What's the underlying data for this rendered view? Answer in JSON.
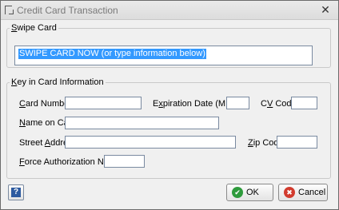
{
  "window": {
    "title": "Credit Card Transaction",
    "close_glyph": "✕"
  },
  "swipe": {
    "legend_key": "S",
    "legend_rest": "wipe Card",
    "field_value": "SWIPE CARD NOW (or type information below)"
  },
  "key_in": {
    "legend_key": "K",
    "legend_rest": "ey in Card Information",
    "card_number": {
      "key": "C",
      "rest": "ard Number",
      "value": ""
    },
    "expiration": {
      "pre": "E",
      "key": "x",
      "rest": "piration Date (MMYY)",
      "value": ""
    },
    "cv_code": {
      "pre": "C",
      "key": "V",
      "rest": " Code",
      "value": ""
    },
    "name_on_card": {
      "key": "N",
      "rest": "ame on Card",
      "value": ""
    },
    "street_address": {
      "pre": "Street ",
      "key": "A",
      "rest": "ddress",
      "value": ""
    },
    "zip_code": {
      "key": "Z",
      "rest": "ip Code",
      "value": ""
    },
    "force_auth": {
      "key": "F",
      "rest": "orce Authorization Number",
      "value": ""
    }
  },
  "buttons": {
    "help_icon": "help-icon",
    "ok_label": "OK",
    "cancel_label": "Cancel"
  },
  "colors": {
    "selection": "#3399ff",
    "ok_icon": "#2e9b3c",
    "cancel_icon": "#d23b2e"
  }
}
